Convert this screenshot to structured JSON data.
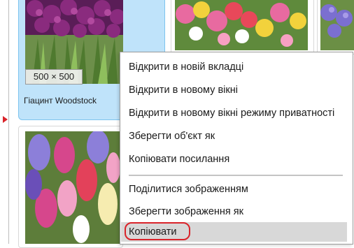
{
  "images": [
    {
      "size_label": "500 × 500",
      "caption": "Гіацинт Woodstock"
    }
  ],
  "context_menu": {
    "items": [
      {
        "label": "Відкрити в новій вкладці"
      },
      {
        "label": "Відкрити в новому вікні"
      },
      {
        "label": "Відкрити в новому вікні режиму приватності"
      },
      {
        "label": "Зберегти об'єкт як"
      },
      {
        "label": "Копіювати посилання"
      },
      {
        "label": "Поділитися зображенням"
      },
      {
        "label": "Зберегти зображення як"
      },
      {
        "label": "Копіювати"
      }
    ]
  },
  "colors": {
    "selected_tile": "#bfe3fa",
    "highlight": "#d9232a"
  }
}
